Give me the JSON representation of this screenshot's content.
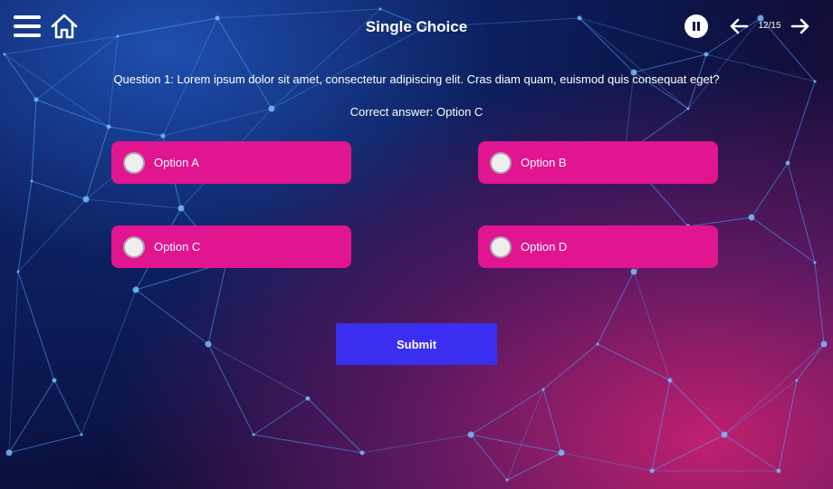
{
  "header": {
    "title": "Single Choice",
    "page_counter": "12/15"
  },
  "icons": {
    "menu": "hamburger-menu-icon",
    "home": "home-icon",
    "pause": "pause-icon",
    "prev": "arrow-left-icon",
    "next": "arrow-right-icon"
  },
  "quiz": {
    "question": "Question 1: Lorem ipsum dolor sit amet, consectetur adipiscing elit. Cras diam quam, euismod quis consequat eget?",
    "correct_answer": "Correct answer: Option C",
    "options": [
      {
        "label": "Option A"
      },
      {
        "label": "Option B"
      },
      {
        "label": "Option C"
      },
      {
        "label": "Option D"
      }
    ],
    "submit_label": "Submit"
  },
  "colors": {
    "option_bg": "#e0158f",
    "submit_bg": "#3a2ff0",
    "background_dark": "#0a0d35"
  }
}
